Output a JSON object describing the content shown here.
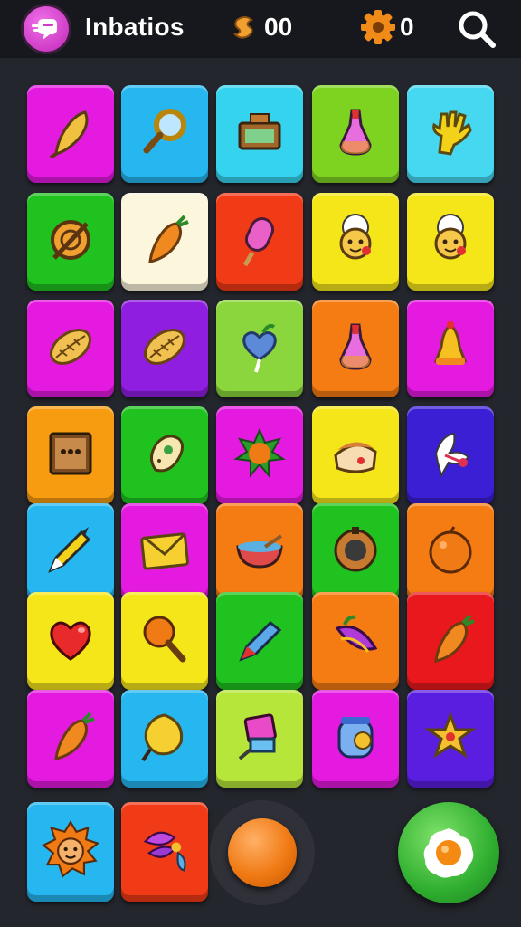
{
  "header": {
    "title": "Inbatios",
    "coins": "00",
    "gears": "0",
    "logo_icon": "chat-bubble-icon",
    "coin_icon": "coin-stack-icon",
    "gear_icon": "gear-icon",
    "search_icon": "search-icon"
  },
  "board": {
    "rows": [
      [
        {
          "color": "#e51ae0",
          "item": "feather-icon"
        },
        {
          "color": "#26b7f0",
          "item": "magnifier-icon"
        },
        {
          "color": "#35d3ee",
          "item": "treasure-chest-icon"
        },
        {
          "color": "#7ed321",
          "item": "potion-bottle-icon"
        },
        {
          "color": "#46d8f0",
          "item": "glove-icon"
        }
      ],
      [
        {
          "color": "#1fc21f",
          "item": "shield-icon"
        },
        {
          "color": "#fbf6dc",
          "item": "carrot-icon"
        },
        {
          "color": "#f13a16",
          "item": "popsicle-icon"
        },
        {
          "color": "#f5e61a",
          "item": "chef-face-icon"
        },
        {
          "color": "#f5e61a",
          "item": "chef-face-icon"
        }
      ],
      [
        {
          "color": "#e51ae0",
          "item": "seed-icon"
        },
        {
          "color": "#8f1ee0",
          "item": "seed-icon"
        },
        {
          "color": "#8bd63c",
          "item": "heart-lollipop-icon"
        },
        {
          "color": "#f57c12",
          "item": "potion-bottle-icon"
        },
        {
          "color": "#e51ae0",
          "item": "bell-icon"
        }
      ],
      [
        {
          "color": "#f79c10",
          "item": "board-icon"
        },
        {
          "color": "#1fc21f",
          "item": "egg-icon"
        },
        {
          "color": "#e51ae0",
          "item": "sun-icon"
        },
        {
          "color": "#f5e61a",
          "item": "pie-icon"
        },
        {
          "color": "#3a1fd4",
          "item": "bird-icon"
        }
      ],
      [
        {
          "color": "#26b7f0",
          "item": "pencil-icon"
        },
        {
          "color": "#e51ae0",
          "item": "envelope-icon"
        },
        {
          "color": "#f57c12",
          "item": "bowl-icon"
        },
        {
          "color": "#1fc21f",
          "item": "ring-icon"
        },
        {
          "color": "#f57c12",
          "item": "orange-icon"
        }
      ],
      [
        {
          "color": "#f5e61a",
          "item": "heart-icon"
        },
        {
          "color": "#f5e61a",
          "item": "lollipop-icon"
        },
        {
          "color": "#1fc21f",
          "item": "crayon-icon"
        },
        {
          "color": "#f57c12",
          "item": "leaf-icon"
        },
        {
          "color": "#e8181c",
          "item": "carrot-icon"
        }
      ],
      [
        {
          "color": "#e51ae0",
          "item": "carrot-icon"
        },
        {
          "color": "#26b7f0",
          "item": "lemon-icon"
        },
        {
          "color": "#b6e63a",
          "item": "eraser-icon"
        },
        {
          "color": "#e51ae0",
          "item": "jar-icon"
        },
        {
          "color": "#5a1ee0",
          "item": "star-icon"
        }
      ]
    ]
  },
  "tray": {
    "tiles": [
      {
        "color": "#26b7f0",
        "item": "lion-icon"
      },
      {
        "color": "#f13a16",
        "item": "flower-icon"
      }
    ],
    "orb_icon": "orange-orb-icon",
    "action_icon": "fried-egg-icon"
  }
}
